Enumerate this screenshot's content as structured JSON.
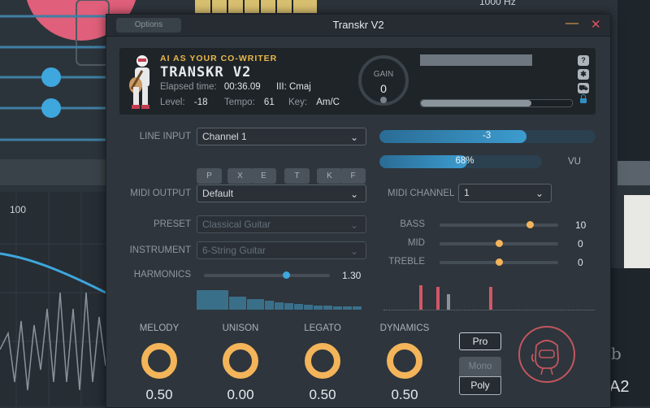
{
  "background": {
    "top_readout": "1000 Hz",
    "axis_value": "100",
    "flat_symbol": "b",
    "corner_text": "A2"
  },
  "window": {
    "title": "Transkr V2",
    "options_label": "Options",
    "minimize_glyph": "—",
    "close_glyph": "✕"
  },
  "header": {
    "tagline": "AI AS YOUR CO-WRITER",
    "product": "TRANSKR V2",
    "elapsed_label": "Elapsed time:",
    "elapsed_value": "00:36.09",
    "chord_label": "III:",
    "chord_value": "Cmaj",
    "level_label": "Level:",
    "level_value": "-18",
    "tempo_label": "Tempo:",
    "tempo_value": "61",
    "key_label": "Key:",
    "key_value": "Am/C",
    "gain_label": "GAIN",
    "gain_value": "0",
    "progress_fraction": 0.73,
    "icons": [
      "help-icon",
      "settings-icon",
      "cart-icon",
      "lock-icon"
    ],
    "icon_glyphs": {
      "help": "?",
      "settings": "✱",
      "cart": "⛟"
    }
  },
  "line_input": {
    "label": "LINE INPUT",
    "value": "Channel 1",
    "chips": [
      "P",
      "X",
      "E",
      "T",
      "K",
      "F"
    ]
  },
  "meters": {
    "level_text": "-3",
    "level_fraction": 0.68,
    "vu_text": "68%",
    "vu_fraction": 0.54,
    "vu_label": "VU"
  },
  "midi": {
    "output_label": "MIDI OUTPUT",
    "output_value": "Default",
    "channel_label": "MIDI CHANNEL",
    "channel_value": "1"
  },
  "preset": {
    "label": "PRESET",
    "value": "Classical Guitar"
  },
  "instrument": {
    "label": "INSTRUMENT",
    "value": "6-String Guitar"
  },
  "harmonics": {
    "label": "HARMONICS",
    "value": "1.30",
    "fraction": 0.65,
    "bars": [
      1.0,
      0.68,
      0.55,
      0.45,
      0.38,
      0.32,
      0.28,
      0.25,
      0.22,
      0.2,
      0.18,
      0.16,
      0.15,
      0.14,
      0.13,
      0.12
    ]
  },
  "eq": {
    "bass": {
      "label": "BASS",
      "value": "10",
      "fraction": 0.76
    },
    "mid": {
      "label": "MID",
      "value": "0",
      "fraction": 0.5
    },
    "treble": {
      "label": "TREBLE",
      "value": "0",
      "fraction": 0.5
    },
    "spikes": [
      {
        "pos": 0.17,
        "h": 1.0,
        "color": "#d25766"
      },
      {
        "pos": 0.25,
        "h": 0.95,
        "color": "#d25766"
      },
      {
        "pos": 0.3,
        "h": 0.62,
        "color": "#8a939b"
      },
      {
        "pos": 0.5,
        "h": 0.95,
        "color": "#d25766"
      }
    ]
  },
  "knobs": [
    {
      "label": "MELODY",
      "value": "0.50"
    },
    {
      "label": "UNISON",
      "value": "0.00"
    },
    {
      "label": "LEGATO",
      "value": "0.50"
    },
    {
      "label": "DYNAMICS",
      "value": "0.50"
    }
  ],
  "mode": {
    "pro": "Pro",
    "mono": "Mono",
    "poly": "Poly"
  },
  "colors": {
    "accent_blue": "#3c9ccf",
    "knob_orange": "#f3b45a",
    "tagline_gold": "#e8b84a",
    "spike_red": "#d25766",
    "close_red": "#e0555a"
  }
}
